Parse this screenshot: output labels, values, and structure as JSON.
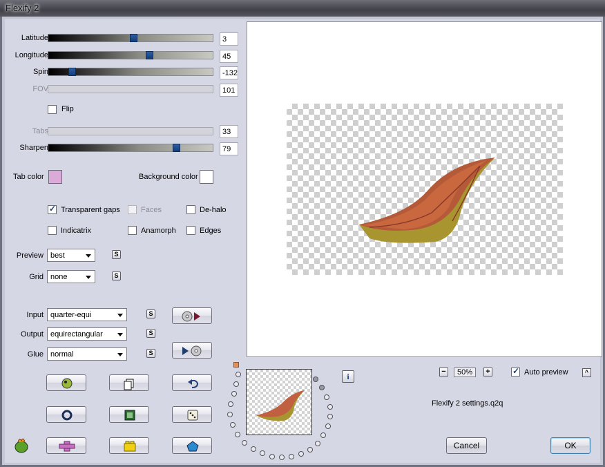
{
  "window": {
    "title": "Flexify 2"
  },
  "sliders": [
    {
      "label": "Latitude",
      "value": "3",
      "enabled": true,
      "level": 0.52
    },
    {
      "label": "Longitude",
      "value": "45",
      "enabled": true,
      "level": 0.63
    },
    {
      "label": "Spin",
      "value": "-132",
      "enabled": true,
      "level": 0.13
    },
    {
      "label": "FOV",
      "value": "101",
      "enabled": false
    },
    {
      "label": "Tabs",
      "value": "33",
      "enabled": false
    },
    {
      "label": "Sharpen",
      "value": "79",
      "enabled": true,
      "level": 0.79
    }
  ],
  "flip": {
    "label": "Flip",
    "checked": false
  },
  "colors": {
    "tab_color_label": "Tab color",
    "tab_color": "#dcaad8",
    "background_color_label": "Background color",
    "background_color": "#ffffff"
  },
  "options": [
    {
      "label": "Transparent gaps",
      "checked": true,
      "enabled": true
    },
    {
      "label": "Faces",
      "checked": false,
      "enabled": false
    },
    {
      "label": "De-halo",
      "checked": false,
      "enabled": true
    },
    {
      "label": "Indicatrix",
      "checked": false,
      "enabled": true
    },
    {
      "label": "Anamorph",
      "checked": false,
      "enabled": true
    },
    {
      "label": "Edges",
      "checked": false,
      "enabled": true
    }
  ],
  "preview_select": {
    "label": "Preview",
    "value": "best"
  },
  "grid_select": {
    "label": "Grid",
    "value": "none"
  },
  "input_select": {
    "label": "Input",
    "value": "quarter-equi"
  },
  "output_select": {
    "label": "Output",
    "value": "equirectangular"
  },
  "glue_select": {
    "label": "Glue",
    "value": "normal"
  },
  "s_button_label": "S",
  "zoom": {
    "minus": "−",
    "value": "50%",
    "plus": "+"
  },
  "auto_preview": {
    "label": "Auto preview",
    "checked": true
  },
  "settings_file": "Flexify 2 settings.q2q",
  "buttons": {
    "cancel": "Cancel",
    "ok": "OK",
    "info": "i",
    "collapse": "^"
  },
  "accent_colors": {
    "slider_thumb": "#1f4d91",
    "swatch_tab": "#dcaad8"
  }
}
